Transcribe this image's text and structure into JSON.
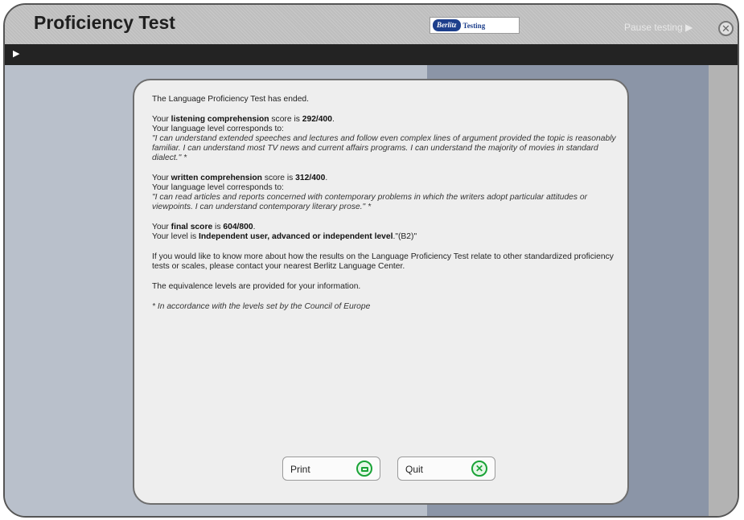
{
  "header": {
    "title": "Proficiency Test",
    "logo_mark": "Berlitz",
    "logo_word": "Testing",
    "pause_label": "Pause testing ▶",
    "close_icon": "close-icon"
  },
  "toolbar": {
    "play_icon": "play-icon"
  },
  "results": {
    "intro": "The Language Proficiency Test has ended.",
    "listening": {
      "prefix": "Your ",
      "skill": "listening comprehension",
      "mid": " score is ",
      "score": "292/400",
      "end": ".",
      "level_intro": "Your language level corresponds to:",
      "description": "\"I can understand extended speeches and lectures and follow even complex lines of argument provided the topic is reasonably familiar. I can understand most TV news and current affairs programs. I can understand the majority of movies in standard dialect.\" *"
    },
    "written": {
      "prefix": "Your ",
      "skill": "written comprehension",
      "mid": " score is ",
      "score": "312/400",
      "end": ".",
      "level_intro": "Your language level corresponds to:",
      "description": "\"I can read articles and reports concerned with contemporary problems in which the writers adopt particular attitudes or viewpoints. I can understand contemporary literary prose.\" *"
    },
    "final": {
      "prefix": "Your ",
      "label": "final score",
      "mid": " is ",
      "score": "604/800",
      "end": ".",
      "level_prefix": "Your level is ",
      "level": "Independent user, advanced or independent level",
      "level_suffix": ".\"(B2)\""
    },
    "more_info": "If you would like to know more about how the results on the Language Proficiency Test relate to other standardized proficiency tests or scales, please contact your nearest Berlitz Language Center.",
    "equivalence_note": "The equivalence levels are provided for your information.",
    "footnote": "* In accordance with the levels set by the Council of Europe"
  },
  "buttons": {
    "print_label": "Print",
    "print_icon": "printer-icon",
    "quit_label": "Quit",
    "quit_icon": "close-circle-icon",
    "quit_glyph": "✕"
  },
  "colors": {
    "accent_green": "#1aa337",
    "toolbar": "#232323",
    "logo_blue": "#1d3f8c"
  }
}
